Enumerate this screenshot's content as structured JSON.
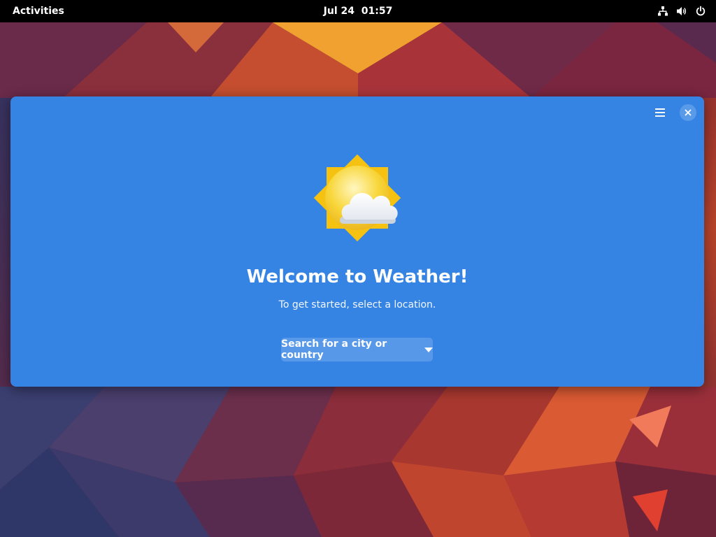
{
  "topbar": {
    "activities_label": "Activities",
    "clock": "Jul 24  01:57",
    "tray_icons": [
      "network-icon",
      "volume-icon",
      "power-icon"
    ]
  },
  "window": {
    "title_icon": "weather-few-clouds-icon",
    "welcome_title": "Welcome to Weather!",
    "welcome_subtitle": "To get started, select a location.",
    "search_label": "Search for a city or country",
    "menu_icon": "hamburger-menu-icon",
    "close_icon": "close-icon",
    "accent_color": "#3584e4"
  },
  "colors": {
    "topbar": "#000000",
    "window_bg": "#3584e4",
    "sun": "#f6c82b",
    "cloud": "#ffffff"
  }
}
